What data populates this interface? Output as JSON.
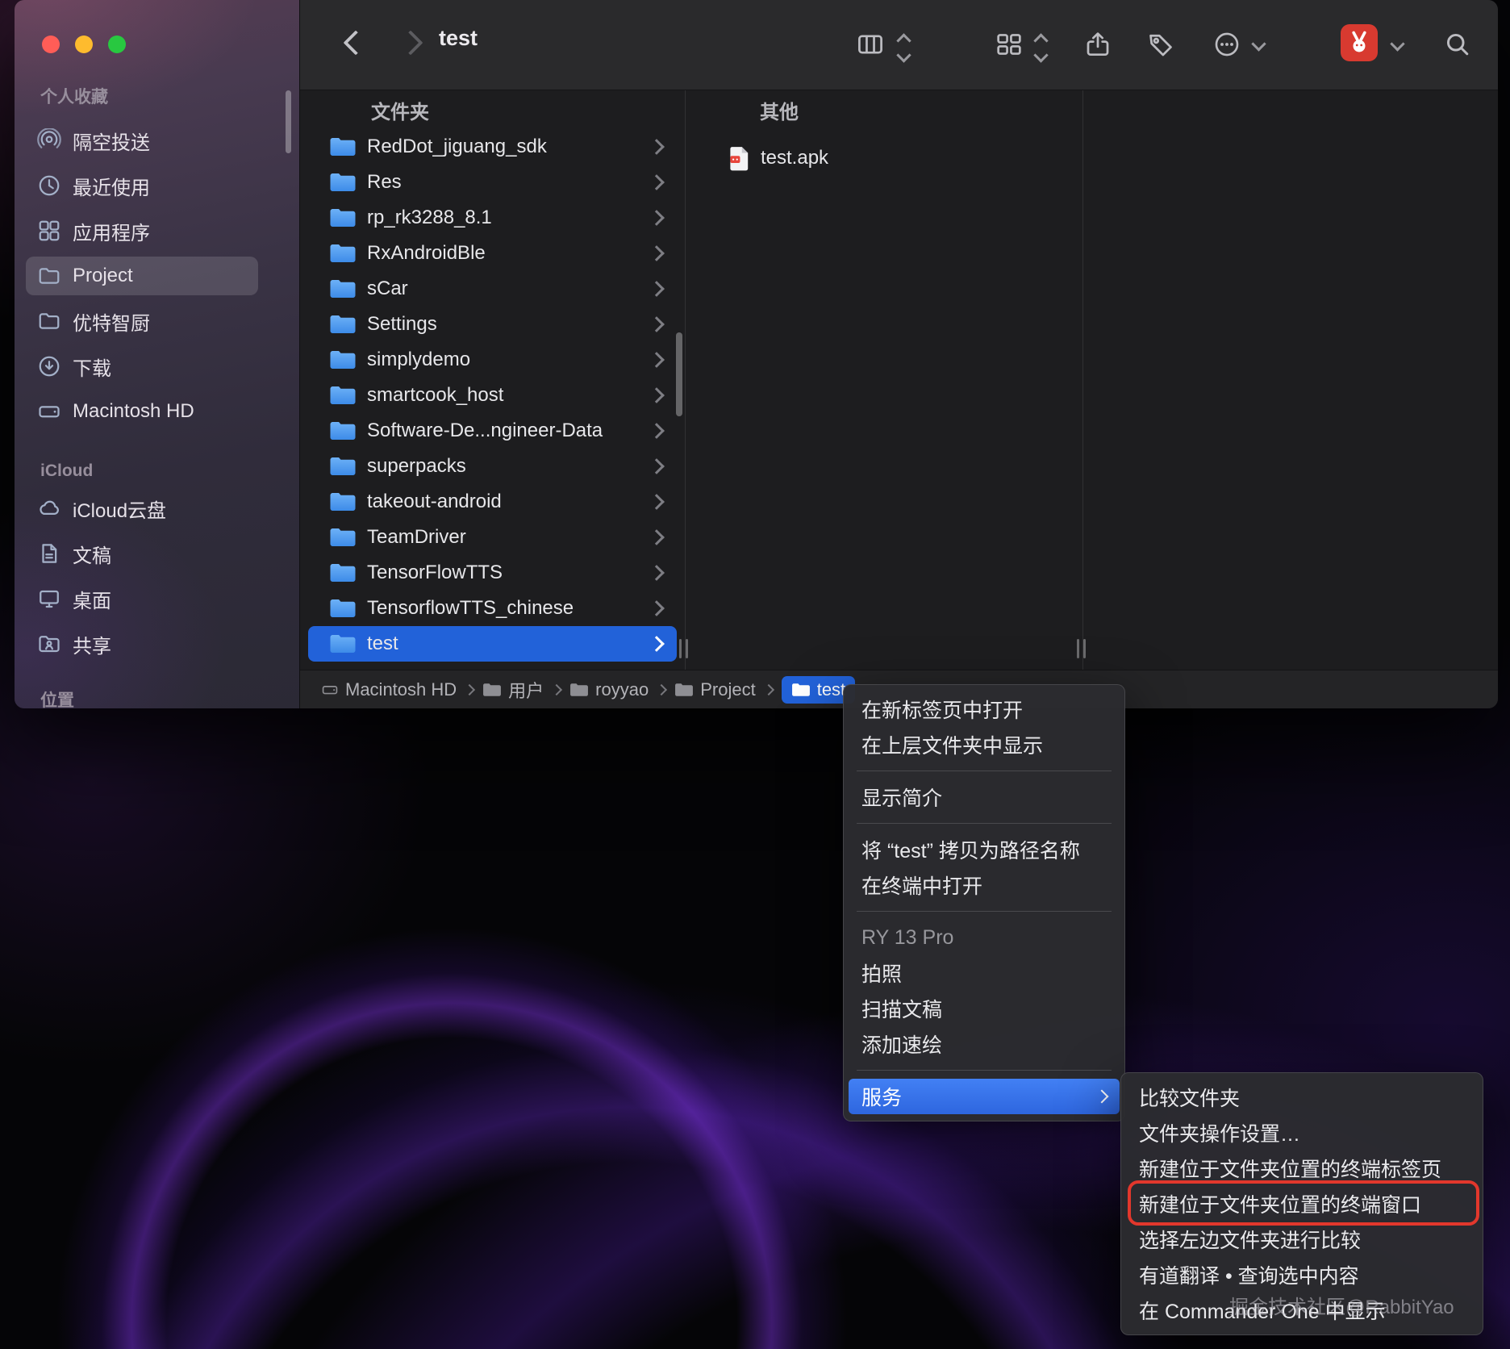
{
  "window": {
    "title": "test"
  },
  "sidebar": {
    "favorites_header": "个人收藏",
    "favorites": [
      {
        "label": "隔空投送"
      },
      {
        "label": "最近使用"
      },
      {
        "label": "应用程序"
      },
      {
        "label": "Project"
      },
      {
        "label": "优特智厨"
      },
      {
        "label": "下载"
      },
      {
        "label": "Macintosh HD"
      }
    ],
    "icloud_header": "iCloud",
    "icloud": [
      {
        "label": "iCloud云盘"
      },
      {
        "label": "文稿"
      },
      {
        "label": "桌面"
      },
      {
        "label": "共享"
      }
    ],
    "locations_header": "位置"
  },
  "columns": {
    "folders": {
      "header": "文件夹",
      "items": [
        {
          "name": "RedDot_jiguang_sdk"
        },
        {
          "name": "Res"
        },
        {
          "name": "rp_rk3288_8.1"
        },
        {
          "name": "RxAndroidBle"
        },
        {
          "name": "sCar"
        },
        {
          "name": "Settings"
        },
        {
          "name": "simplydemo"
        },
        {
          "name": "smartcook_host"
        },
        {
          "name": "Software-De...ngineer-Data"
        },
        {
          "name": "superpacks"
        },
        {
          "name": "takeout-android"
        },
        {
          "name": "TeamDriver"
        },
        {
          "name": "TensorFlowTTS"
        },
        {
          "name": "TensorflowTTS_chinese"
        },
        {
          "name": "test"
        }
      ]
    },
    "others": {
      "header": "其他",
      "items": [
        {
          "name": "test.apk"
        }
      ]
    }
  },
  "pathbar": {
    "items": [
      {
        "label": "Macintosh HD"
      },
      {
        "label": "用户"
      },
      {
        "label": "royyao"
      },
      {
        "label": "Project"
      },
      {
        "label": "test"
      }
    ]
  },
  "context_menu": {
    "items": [
      {
        "label": "在新标签页中打开"
      },
      {
        "label": "在上层文件夹中显示"
      },
      {
        "label": "显示简介"
      },
      {
        "label": "将 “test” 拷贝为路径名称"
      },
      {
        "label": "在终端中打开"
      },
      {
        "label": "RY 13 Pro"
      },
      {
        "label": "拍照"
      },
      {
        "label": "扫描文稿"
      },
      {
        "label": "添加速绘"
      },
      {
        "label": "服务"
      }
    ]
  },
  "services_submenu": {
    "items": [
      {
        "label": "比较文件夹"
      },
      {
        "label": "文件夹操作设置…"
      },
      {
        "label": "新建位于文件夹位置的终端标签页"
      },
      {
        "label": "新建位于文件夹位置的终端窗口"
      },
      {
        "label": "选择左边文件夹进行比较"
      },
      {
        "label": "有道翻译 • 查询选中内容"
      },
      {
        "label": "在 Commander One 中显示"
      }
    ]
  },
  "watermark": "掘金技术社区@RabbitYao",
  "colors": {
    "accent_blue": "#2262d9",
    "menu_highlight_blue": "#3273e8",
    "annotation_red": "#e2372c",
    "folder_blue": "#4aa3f0"
  }
}
